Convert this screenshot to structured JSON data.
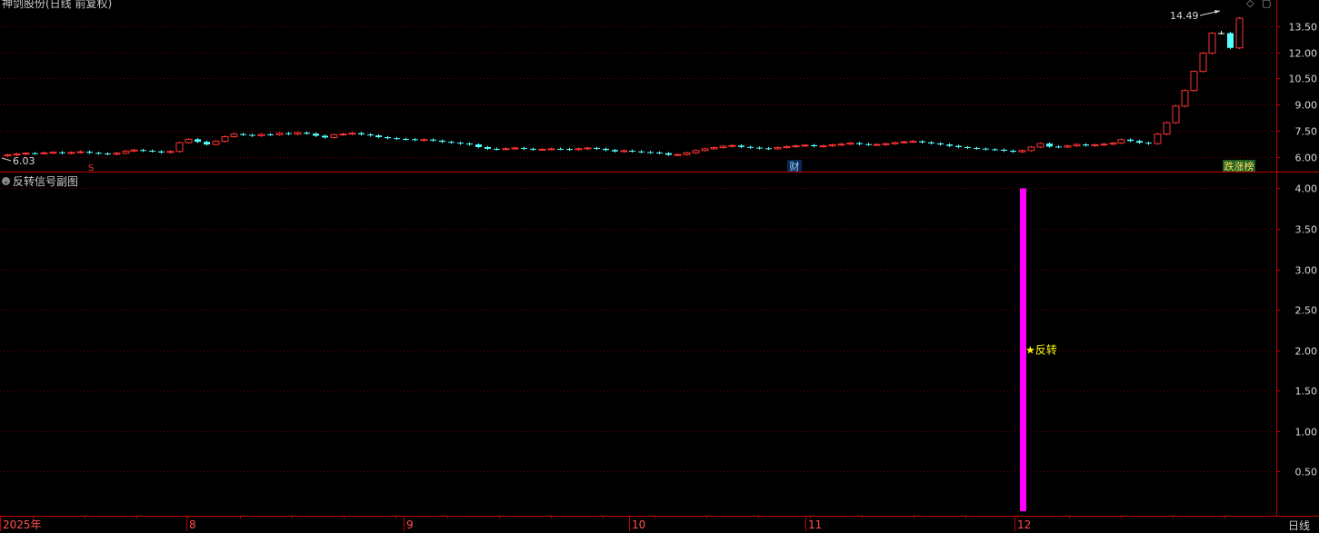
{
  "upper_panel": {
    "title": "神剑股份(日线 前复权)",
    "high_label": "14.49",
    "low_label": "6.03",
    "events": {
      "s_marker": "S",
      "cai_marker": "财",
      "board_marker": "跌涨榜"
    }
  },
  "lower_panel": {
    "title": "反转信号副图",
    "signal_label": "★反转"
  },
  "footer": {
    "period_label": "日线"
  },
  "colors": {
    "up": "#ff3232",
    "down": "#54ffff",
    "flat": "#ffffff",
    "grid": "#7a0000",
    "axis": "#c00000",
    "signal": "#ff00ff",
    "tick_text": "#d8d8d8",
    "signal_text": "#ffff00",
    "date_text": "#ff5050"
  },
  "chart_data": [
    {
      "type": "candlestick",
      "title": "神剑股份(日线 前复权)",
      "ylim": [
        5.4,
        14.9
      ],
      "y_ticks": [
        "13.50",
        "12.00",
        "10.50",
        "9.00",
        "7.50",
        "6.00"
      ],
      "grid": true,
      "annotations": [
        "14.49",
        "6.03",
        "S",
        "财",
        "跌涨榜"
      ],
      "close": [
        6.1,
        6.15,
        6.2,
        6.18,
        6.22,
        6.25,
        6.2,
        6.24,
        6.28,
        6.22,
        6.18,
        6.14,
        6.2,
        6.32,
        6.38,
        6.34,
        6.3,
        6.24,
        6.3,
        6.8,
        7.0,
        6.85,
        6.7,
        6.88,
        7.15,
        7.3,
        7.25,
        7.2,
        7.28,
        7.26,
        7.35,
        7.3,
        7.38,
        7.32,
        7.2,
        7.1,
        7.26,
        7.3,
        7.35,
        7.28,
        7.22,
        7.12,
        7.06,
        7.02,
        7.0,
        6.95,
        6.98,
        6.92,
        6.85,
        6.8,
        6.75,
        6.7,
        6.55,
        6.45,
        6.42,
        6.46,
        6.5,
        6.45,
        6.4,
        6.42,
        6.45,
        6.44,
        6.4,
        6.46,
        6.5,
        6.45,
        6.38,
        6.3,
        6.34,
        6.3,
        6.26,
        6.24,
        6.2,
        6.1,
        6.12,
        6.22,
        6.35,
        6.45,
        6.52,
        6.6,
        6.64,
        6.56,
        6.52,
        6.48,
        6.45,
        6.52,
        6.58,
        6.62,
        6.66,
        6.6,
        6.62,
        6.68,
        6.72,
        6.78,
        6.72,
        6.68,
        6.7,
        6.74,
        6.8,
        6.85,
        6.88,
        6.82,
        6.76,
        6.7,
        6.62,
        6.55,
        6.5,
        6.46,
        6.42,
        6.4,
        6.34,
        6.28,
        6.35,
        6.55,
        6.75,
        6.58,
        6.55,
        6.62,
        6.7,
        6.64,
        6.68,
        6.72,
        6.78,
        6.98,
        6.9,
        6.8,
        6.75,
        7.3,
        7.95,
        8.9,
        9.8,
        10.9,
        11.95,
        13.1,
        13.1,
        12.25,
        13.95
      ],
      "x_ticks": [
        "2025年",
        "8",
        "9",
        "10",
        "11",
        "12"
      ]
    },
    {
      "type": "bar",
      "title": "反转信号副图",
      "ylim": [
        0,
        4.15
      ],
      "y_ticks": [
        "4.00",
        "3.50",
        "3.00",
        "2.50",
        "2.00",
        "1.50",
        "1.00",
        "0.50"
      ],
      "grid": true,
      "signal": {
        "date_tick": "12",
        "value": 4.0,
        "label": "★反转",
        "label_value": 2.0
      }
    }
  ]
}
